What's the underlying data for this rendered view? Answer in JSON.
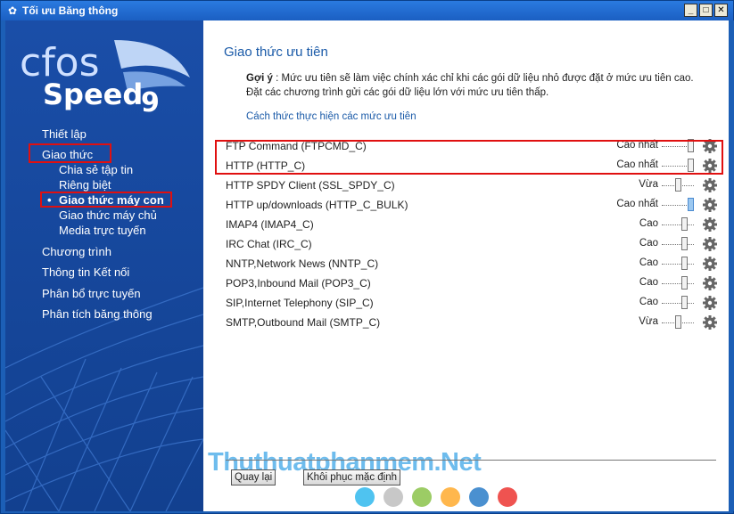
{
  "window": {
    "title": "Tối ưu Băng thông",
    "icon": "gear-icon",
    "min_label": "_",
    "max_label": "□",
    "close_label": "✕"
  },
  "logo": {
    "line1": "cfos",
    "line2": "Speed",
    "version": "9"
  },
  "sidebar": {
    "items": [
      {
        "label": "Thiết lập"
      },
      {
        "label": "Giao thức"
      },
      {
        "label": "Chia sẻ tập tin"
      },
      {
        "label": "Riêng biệt"
      },
      {
        "label": "Giao thức máy con"
      },
      {
        "label": "Giao thức máy chủ"
      },
      {
        "label": "Media trực tuyến"
      },
      {
        "label": "Chương trình"
      },
      {
        "label": "Thông tin Kết nối"
      },
      {
        "label": "Phân bổ trực tuyến"
      },
      {
        "label": "Phân tích băng thông"
      }
    ],
    "bullet": "•"
  },
  "content": {
    "title": "Giao thức ưu tiên",
    "hint_label": "Gợi ý",
    "hint_text": " : Mức ưu tiên sẽ làm việc chính xác chỉ khi các gói dữ liệu nhỏ được đặt ở mức ưu tiên cao. Đặt các chương trình gửi các gói dữ liệu lớn với mức ưu tiên thấp.",
    "link": "Cách thức thực hiện các mức ưu tiên",
    "protocols": [
      {
        "name": "FTP Command (FTPCMD_C)",
        "level": "Cao nhất",
        "value": 4
      },
      {
        "name": "HTTP (HTTP_C)",
        "level": "Cao nhất",
        "value": 4
      },
      {
        "name": "HTTP SPDY Client (SSL_SPDY_C)",
        "level": "Vừa",
        "value": 2
      },
      {
        "name": "HTTP up/downloads (HTTP_C_BULK)",
        "level": "Cao nhất",
        "value": 4
      },
      {
        "name": "IMAP4 (IMAP4_C)",
        "level": "Cao",
        "value": 3
      },
      {
        "name": "IRC Chat (IRC_C)",
        "level": "Cao",
        "value": 3
      },
      {
        "name": "NNTP,Network News (NNTP_C)",
        "level": "Cao",
        "value": 3
      },
      {
        "name": "POP3,Inbound Mail (POP3_C)",
        "level": "Cao",
        "value": 3
      },
      {
        "name": "SIP,Internet Telephony (SIP_C)",
        "level": "Cao",
        "value": 3
      },
      {
        "name": "SMTP,Outbound Mail (SMTP_C)",
        "level": "Vừa",
        "value": 2
      }
    ],
    "back_button": "Quay lại",
    "restore_button": "Khôi phục mặc định",
    "watermark": "Thuthuatphanmem.Net",
    "dot_colors": [
      "#4fc3f0",
      "#c8c8c8",
      "#9ccc65",
      "#ffb74d",
      "#4a90d0",
      "#ef5350"
    ]
  },
  "colors": {
    "accent": "#1a5aa8",
    "highlight": "#e01010",
    "sidebar": "#174aa3"
  }
}
